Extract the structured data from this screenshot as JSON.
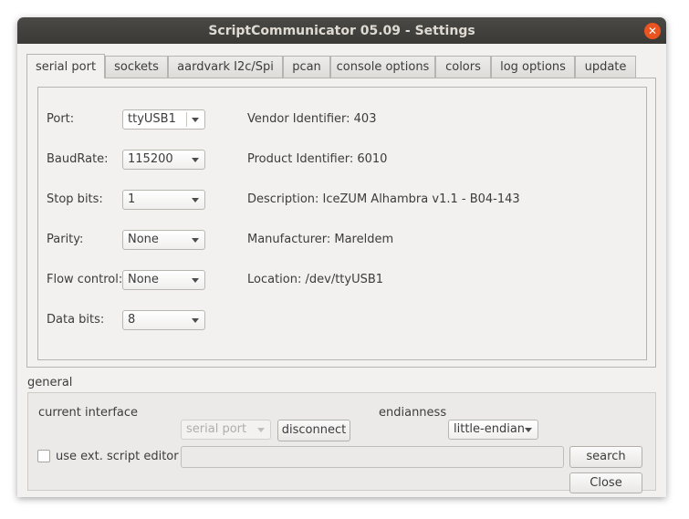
{
  "window": {
    "title": "ScriptCommunicator 05.09 - Settings",
    "close_glyph": "✕"
  },
  "tabs": [
    {
      "label": "serial port"
    },
    {
      "label": "sockets"
    },
    {
      "label": "aardvark I2c/Spi"
    },
    {
      "label": "pcan"
    },
    {
      "label": "console options"
    },
    {
      "label": "colors"
    },
    {
      "label": "log options"
    },
    {
      "label": "update"
    }
  ],
  "serial": {
    "port_label": "Port:",
    "port_value": "ttyUSB1",
    "baud_label": "BaudRate:",
    "baud_value": "115200",
    "stopbits_label": "Stop bits:",
    "stopbits_value": "1",
    "parity_label": "Parity:",
    "parity_value": "None",
    "flow_label": "Flow control:",
    "flow_value": "None",
    "databits_label": "Data bits:",
    "databits_value": "8",
    "vendor": "Vendor Identifier: 403",
    "product": "Product Identifier: 6010",
    "description": "Description: IceZUM Alhambra v1.1 - B04-143",
    "manufacturer": "Manufacturer: Mareldem",
    "location": "Location: /dev/ttyUSB1"
  },
  "general": {
    "title": "general",
    "current_interface_label": "current interface",
    "current_interface_value": "serial port",
    "disconnect_label": "disconnect",
    "endianness_label": "endianness",
    "endianness_value": "little-endian",
    "use_ext_editor_label": "use ext. script editor",
    "use_ext_editor_checked": false,
    "editor_path": "",
    "search_label": "search",
    "close_label": "Close"
  },
  "colors": {
    "accent": "#e95420",
    "titlebar": "#3c3b37",
    "window_bg": "#f2f1f0"
  }
}
